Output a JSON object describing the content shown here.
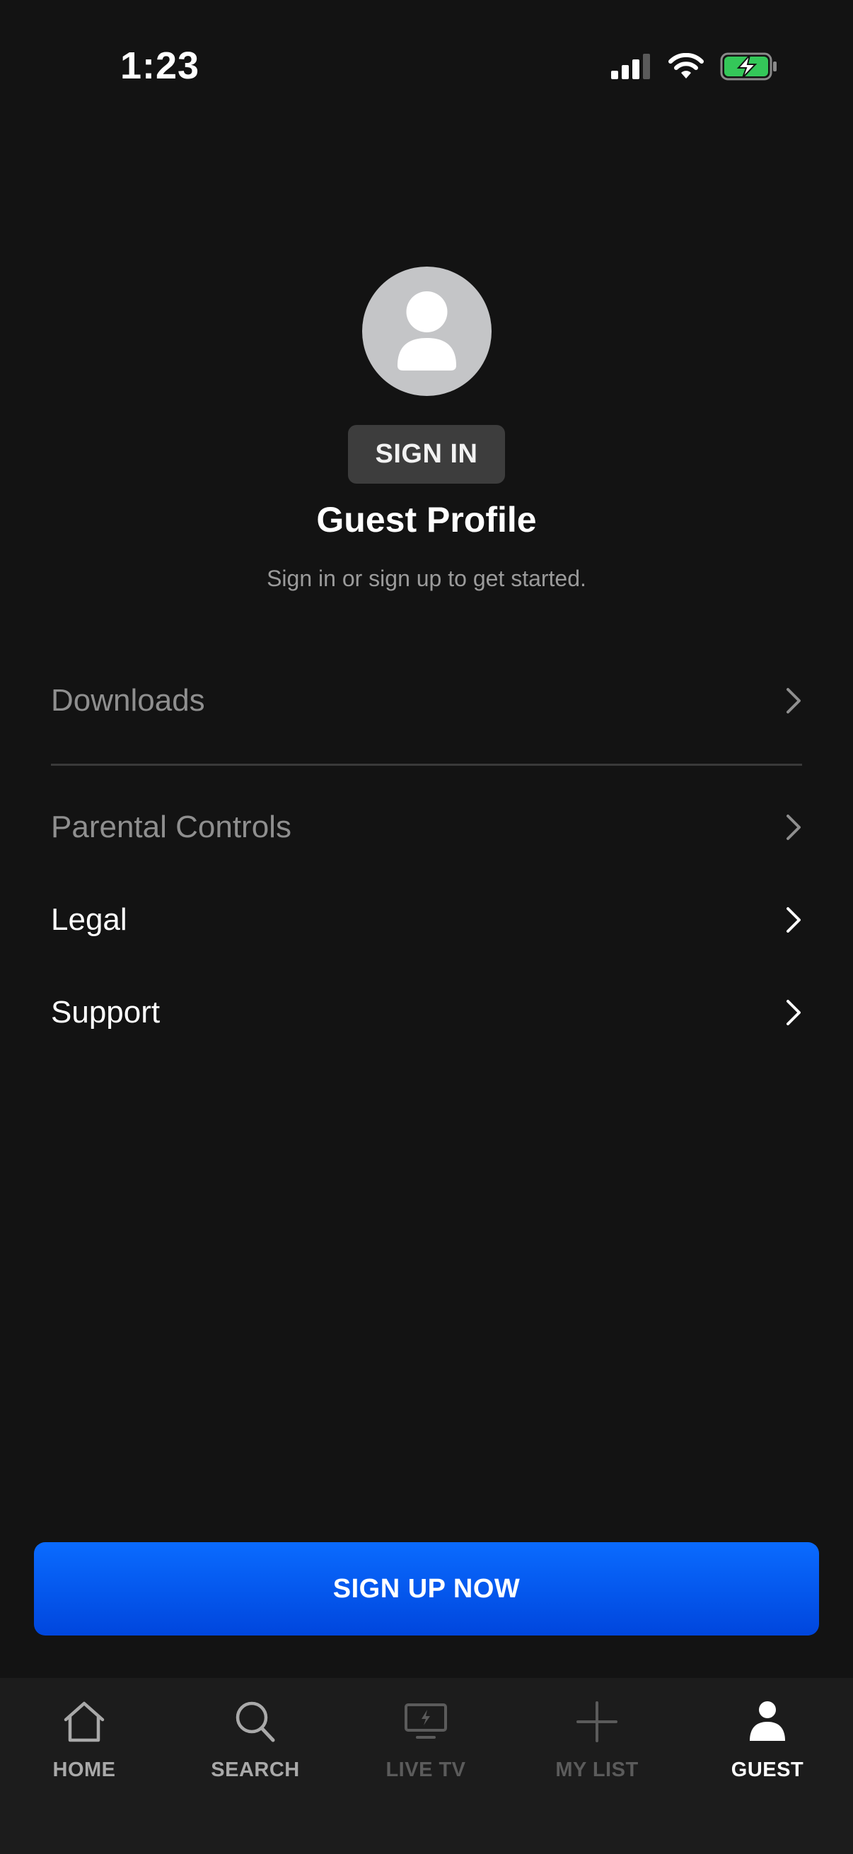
{
  "status_bar": {
    "time": "1:23"
  },
  "profile": {
    "sign_in_label": "SIGN IN",
    "title": "Guest Profile",
    "subtitle": "Sign in or sign up to get started."
  },
  "menu": {
    "items": [
      {
        "label": "Downloads",
        "icon": "chevron-right-icon"
      },
      {
        "label": "Parental Controls",
        "icon": "chevron-right-icon"
      },
      {
        "label": "Legal",
        "icon": "chevron-right-icon"
      },
      {
        "label": "Support",
        "icon": "chevron-right-icon"
      }
    ]
  },
  "cta": {
    "label": "SIGN UP NOW"
  },
  "tabbar": {
    "tabs": [
      {
        "label": "HOME",
        "icon": "home-icon"
      },
      {
        "label": "SEARCH",
        "icon": "search-icon"
      },
      {
        "label": "LIVE TV",
        "icon": "live-tv-icon"
      },
      {
        "label": "MY LIST",
        "icon": "plus-icon"
      },
      {
        "label": "GUEST",
        "icon": "profile-icon",
        "active": true
      }
    ]
  },
  "colors": {
    "background": "#131313",
    "tabbar_background": "#1c1c1c",
    "accent_blue": "#0a6bff",
    "battery_green": "#34c759"
  }
}
